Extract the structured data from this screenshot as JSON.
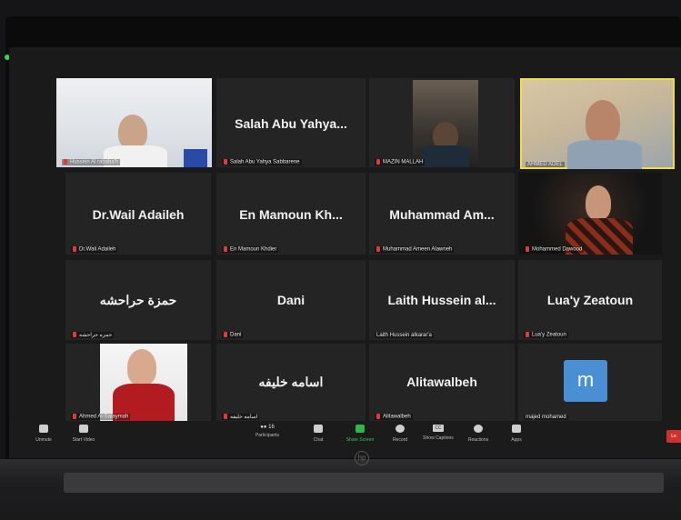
{
  "tiles": [
    {
      "big": "",
      "name": "Hussein Al rababa'h",
      "muted": true
    },
    {
      "big": "Salah Abu Yahya...",
      "name": "Salah Abu Yahya Sabbarene",
      "muted": true
    },
    {
      "big": "",
      "name": "MAZIN MALLAH",
      "muted": true
    },
    {
      "big": "",
      "name": "AHMED ADEL",
      "muted": false
    },
    {
      "big": "Dr.Wail Adaileh",
      "name": "Dr.Wail Adaileh",
      "muted": true
    },
    {
      "big": "En Mamoun Kh...",
      "name": "En Mamoun Khdier",
      "muted": true
    },
    {
      "big": "Muhammad Am...",
      "name": "Muhammad Ameen Alawneh",
      "muted": true
    },
    {
      "big": "",
      "name": "Mohammed Dawood",
      "muted": true
    },
    {
      "big": "حمزة حراحشه",
      "name": "حمزه حراحشه",
      "muted": true
    },
    {
      "big": "Dani",
      "name": "Dani",
      "muted": true
    },
    {
      "big": "Laith Hussein al...",
      "name": "Laith Hussein alkarar'a",
      "muted": false
    },
    {
      "big": "Lua'y Zeatoun",
      "name": "Lua'y Zeatoun",
      "muted": true
    },
    {
      "big": "",
      "name": "Ahmed Al-Salaymah",
      "muted": true
    },
    {
      "big": "اسامه خليفه",
      "name": "اسامه خليفه",
      "muted": true
    },
    {
      "big": "Alitawalbeh",
      "name": "Alitawalbeh",
      "muted": true
    },
    {
      "big": "",
      "name": "majed mohamed",
      "muted": false,
      "avatar_letter": "m"
    }
  ],
  "toolbar": {
    "unmute": "Unmute",
    "start_video": "Start Video",
    "participants": "Participants",
    "participants_count": "16",
    "chat": "Chat",
    "share_screen": "Share Screen",
    "record": "Record",
    "show_captions": "Show Captions",
    "cc_label": "CC",
    "reactions": "Reactions",
    "apps": "Apps",
    "leave": "Le"
  },
  "brand": "hp",
  "colors": {
    "share_green": "#30b847",
    "leave_red": "#d0312d",
    "active_speaker": "#f1dc4a",
    "avatar_blue": "#4a8fd4",
    "mute_red": "#e03a3a"
  }
}
